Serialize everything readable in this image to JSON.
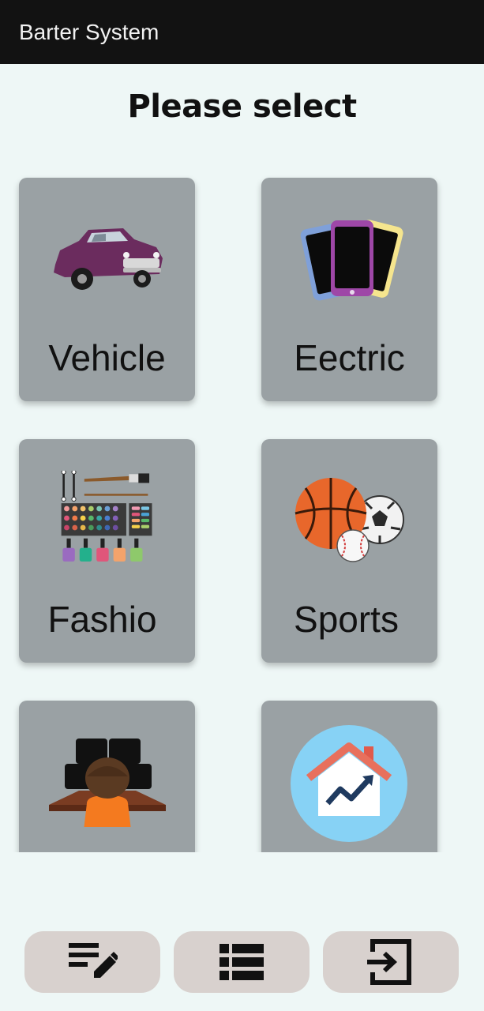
{
  "app_bar": {
    "title": "Barter System"
  },
  "page": {
    "heading": "Please select"
  },
  "categories": [
    {
      "label": "Vehicle",
      "icon": "car-icon"
    },
    {
      "label": "Eectric",
      "icon": "phones-icon"
    },
    {
      "label": "Fashio",
      "icon": "makeup-palette-icon"
    },
    {
      "label": "Sports",
      "icon": "sports-balls-icon"
    },
    {
      "label": "",
      "icon": "computer-desk-icon"
    },
    {
      "label": "",
      "icon": "house-chart-icon"
    }
  ],
  "bottom_nav": [
    {
      "icon": "edit-list-icon"
    },
    {
      "icon": "list-view-icon"
    },
    {
      "icon": "logout-icon"
    }
  ],
  "colors": {
    "app_bar": "#121212",
    "background": "#eef7f6",
    "card": "#9aa1a4",
    "nav_button": "#d8d1ce"
  }
}
